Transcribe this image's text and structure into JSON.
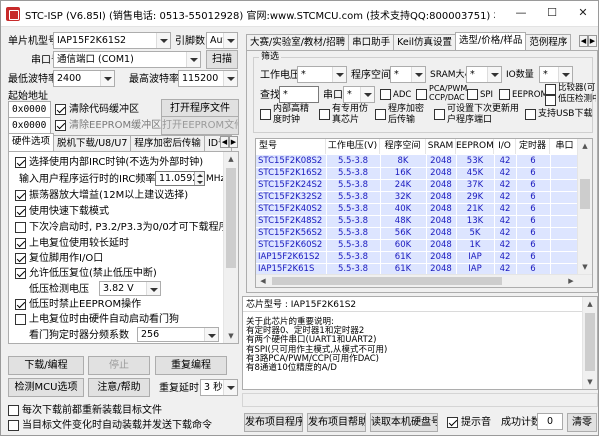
{
  "window": {
    "title": "STC-ISP (V6.85I) (销售电话: 0513-55012928) 官网:www.STCMCU.com (技术支持QQ:800003751) 本软件定价: 60...",
    "minimize": "—",
    "maximize": "☐",
    "close": "✕"
  },
  "left": {
    "mcu_type_label": "单片机型号",
    "mcu_type_value": "IAP15F2K61S2",
    "pin_label": "引脚数",
    "pin_value": "Auto",
    "port_label": "串口号",
    "port_value": "通信端口 (COM1)",
    "scan_button": "扫描",
    "min_baud_label": "最低波特率",
    "min_baud_value": "2400",
    "max_baud_label": "最高波特率",
    "max_baud_value": "115200",
    "start_addr_label": "起始地址",
    "addr1_value": "0x0000",
    "clear_code_label": "清除代码缓冲区",
    "open_program_button": "打开程序文件",
    "addr2_value": "0x0000",
    "clear_eeprom_label": "清除EEPROM缓冲区",
    "open_eeprom_button": "打开EEPROM文件",
    "hw_tabs": [
      "硬件选项",
      "脱机下载/U8/U7",
      "程序加密后传输",
      "ID号"
    ],
    "options": [
      {
        "label": "选择使用内部IRC时钟(不选为外部时钟)",
        "checked": true
      },
      {
        "label": "输入用户程序运行时的IRC频率",
        "checked": false,
        "value": "11.0592",
        "unit": "MHz"
      },
      {
        "label": "振荡器放大增益(12M以上建议选择)",
        "checked": true
      },
      {
        "label": "使用快速下载模式",
        "checked": true
      },
      {
        "label": "下次冷启动时, P3.2/P3.3为0/0才可下载程序",
        "checked": false
      },
      {
        "label": "上电复位使用较长延时",
        "checked": true
      },
      {
        "label": "复位脚用作I/O口",
        "checked": true
      },
      {
        "label": "允许低压复位(禁止低压中断)",
        "checked": true
      },
      {
        "label": "低压检测电压",
        "checked": false,
        "value": "3.82 V"
      },
      {
        "label": "低压时禁止EEPROM操作",
        "checked": true
      },
      {
        "label": "上电复位时由硬件自动启动看门狗",
        "checked": false
      },
      {
        "label": "看门狗定时器分频系数",
        "checked": false,
        "value": "256"
      }
    ],
    "download_button": "下载/编程",
    "stop_button": "停止",
    "reprogram_button": "重复编程",
    "check_mcu_button": "检测MCU选项",
    "help_button": "注意/帮助",
    "repeat_delay_label": "重复延时",
    "repeat_delay_value": "3 秒",
    "reload_label": "每次下载前都重新装载目标文件",
    "auto_send_label": "当目标文件变化时自动装载并发送下载命令"
  },
  "right": {
    "tabs": [
      "大赛/实验室/教材/招聘",
      "串口助手",
      "Keil仿真设置",
      "选型/价格/样品",
      "范例程序"
    ],
    "filter_group_label": "筛选",
    "voltage_label": "工作电压",
    "voltage_value": "*",
    "prog_space_label": "程序空间",
    "prog_space_value": "*",
    "sram_label": "SRAM大小",
    "sram_value": "*",
    "io_label": "IO数量",
    "io_value": "*",
    "search_label": "查找",
    "search_value": "*",
    "uart_label": "串口",
    "uart_value": "*",
    "adc_label": "ADC",
    "pca_label": "PCA/PWM CCP/DAC",
    "spi_label": "SPI",
    "eeprom_label": "EEPROM",
    "comparator_label": "比较器(可当ADC用)",
    "low_voltage_detect_label": "低压检测中断",
    "internal_reset_label": "内部高精度时钟",
    "dedicated_sim_label": "有专用仿真芯片",
    "encrypt_label": "程序加密后传输",
    "user_program_label": "可设置下次更新用户程序端口",
    "usb_label": "支持USB下载",
    "columns": [
      "型号",
      "工作电压(V)",
      "程序空间",
      "SRAM",
      "EEPROM",
      "I/O",
      "定时器",
      "串口"
    ],
    "rows": [
      [
        "STC15F2K08S2",
        "5.5-3.8",
        "8K",
        "2048",
        "53K",
        "42",
        "6"
      ],
      [
        "STC15F2K16S2",
        "5.5-3.8",
        "16K",
        "2048",
        "45K",
        "42",
        "6"
      ],
      [
        "STC15F2K24S2",
        "5.5-3.8",
        "24K",
        "2048",
        "37K",
        "42",
        "6"
      ],
      [
        "STC15F2K32S2",
        "5.5-3.8",
        "32K",
        "2048",
        "29K",
        "42",
        "6"
      ],
      [
        "STC15F2K40S2",
        "5.5-3.8",
        "40K",
        "2048",
        "21K",
        "42",
        "6"
      ],
      [
        "STC15F2K48S2",
        "5.5-3.8",
        "48K",
        "2048",
        "13K",
        "42",
        "6"
      ],
      [
        "STC15F2K56S2",
        "5.5-3.8",
        "56K",
        "2048",
        "5K",
        "42",
        "6"
      ],
      [
        "STC15F2K60S2",
        "5.5-3.8",
        "60K",
        "2048",
        "1K",
        "42",
        "6"
      ],
      [
        "IAP15F2K61S2",
        "5.5-3.8",
        "61K",
        "2048",
        "IAP",
        "42",
        "6"
      ],
      [
        "IAP15F2K61S",
        "5.5-3.8",
        "61K",
        "2048",
        "IAP",
        "42",
        "6"
      ],
      [
        "IAP15F2K63S2",
        "5.5-3.8",
        "63.5K",
        "2048",
        "IAP",
        "42",
        "6"
      ]
    ],
    "chip_label": "芯片型号 : IAP15F2K61S2",
    "info_text": [
      "关于此芯片的重要说明:",
      "有定时器0、定时器1和定时器2",
      "有两个硬件串口(UART1和UART2)",
      "有SPI(只可用作主模式,从模式不可用)",
      "有3路PCA/PWM/CCP(可用作DAC)",
      "有8通道10位精度的A/D"
    ],
    "publish_program_button": "发布项目程序",
    "publish_help_button": "发布项目帮助",
    "read_serial_button": "读取本机硬盘号",
    "beep_label": "提示音",
    "success_count_label": "成功计数",
    "success_count_value": "0",
    "clear_button": "清零"
  },
  "colors": {
    "selected_row_bg": "#dde5ff",
    "selected_row_text": "#1a1abf",
    "app_icon": "#c72a2a"
  }
}
